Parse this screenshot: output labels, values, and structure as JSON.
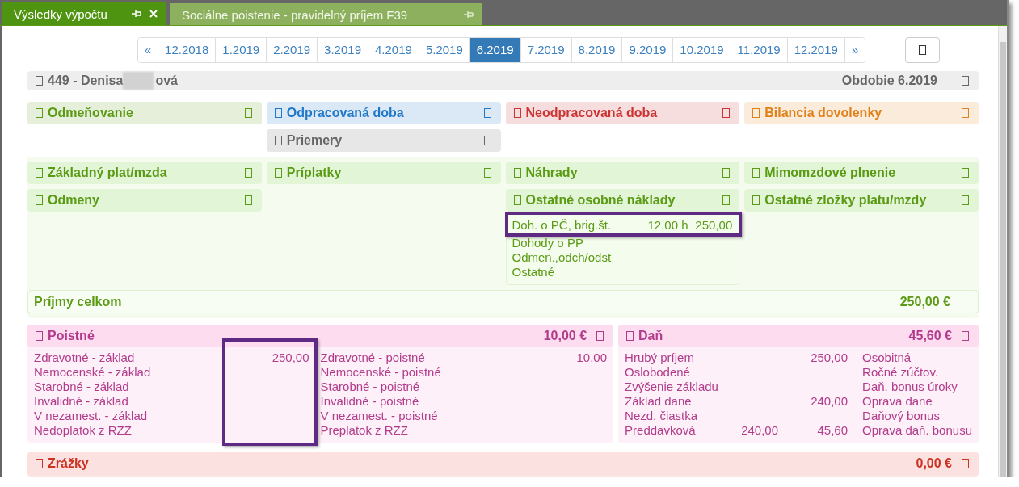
{
  "tabs": [
    {
      "label": "Výsledky výpočtu",
      "selected": true,
      "closable": true
    },
    {
      "label": "Sociálne poistenie - pravidelný príjem F39",
      "selected": false,
      "closable": false
    }
  ],
  "pager": {
    "prev": "«",
    "next": "»",
    "pages": [
      {
        "label": "12.2018",
        "selected": false
      },
      {
        "label": "1.2019",
        "selected": false
      },
      {
        "label": "2.2019",
        "selected": false
      },
      {
        "label": "3.2019",
        "selected": false
      },
      {
        "label": "4.2019",
        "selected": false
      },
      {
        "label": "5.2019",
        "selected": false
      },
      {
        "label": "6.2019",
        "selected": true
      },
      {
        "label": "7.2019",
        "selected": false
      },
      {
        "label": "8.2019",
        "selected": false
      },
      {
        "label": "9.2019",
        "selected": false
      },
      {
        "label": "10.2019",
        "selected": false
      },
      {
        "label": "11.2019",
        "selected": false
      },
      {
        "label": "12.2019",
        "selected": false
      }
    ]
  },
  "employee": {
    "name_start": "449 - Denisa",
    "name_end": "ová",
    "period": "Obdobie 6.2019"
  },
  "overview_columns": [
    [
      {
        "title": "Odmeňovanie",
        "color": "#5b9a14"
      }
    ],
    [
      {
        "title": "Odpracovaná doba",
        "color": "#1f78c8"
      },
      {
        "title": "Priemery",
        "color": "#666666"
      }
    ],
    [
      {
        "title": "Neodpracovaná doba",
        "color": "#cc3333"
      }
    ],
    [
      {
        "title": "Bilancia dovolenky",
        "color": "#e0801a"
      }
    ]
  ],
  "income": {
    "columns": [
      [
        {
          "title": "Základný plat/mzda"
        },
        {
          "title": "Odmeny"
        }
      ],
      [
        {
          "title": "Príplatky"
        }
      ],
      [
        {
          "title": "Náhrady"
        },
        {
          "title": "Ostatné osobné náklady",
          "rows": [
            {
              "label": "Doh. o PČ, brig.št.",
              "hours": "12,00 h",
              "amount": "250,00",
              "highlighted": true
            },
            {
              "label": "Dohody o PP",
              "highlighted": false
            },
            {
              "label": "Odmen.,odch/odst",
              "highlighted": false
            },
            {
              "label": "Ostatné",
              "highlighted": false
            }
          ]
        }
      ],
      [
        {
          "title": "Mimomzdové plnenie"
        },
        {
          "title": "Ostatné zložky platu/mzdy"
        }
      ]
    ],
    "total_label": "Príjmy celkom",
    "total": "250,00 €"
  },
  "insurance": {
    "title": "Poistné",
    "total": "10,00 €",
    "columns": [
      {
        "highlighted": true,
        "rows": [
          {
            "label": "Zdravotné - základ",
            "value": "250,00"
          },
          {
            "label": "Nemocenské - základ"
          },
          {
            "label": "Starobné - základ"
          },
          {
            "label": "Invalidné - základ"
          },
          {
            "label": "V nezamest. - základ"
          },
          {
            "label": "Nedoplatok z RZZ"
          }
        ]
      },
      {
        "highlighted": false,
        "rows": [
          {
            "label": "Zdravotné - poistné",
            "value": "10,00"
          },
          {
            "label": "Nemocenské - poistné"
          },
          {
            "label": "Starobné - poistné"
          },
          {
            "label": "Invalidné - poistné"
          },
          {
            "label": "V nezamest. - poistné"
          },
          {
            "label": "Preplatok z RZZ"
          }
        ]
      }
    ]
  },
  "tax": {
    "title": "Daň",
    "total": "45,60 €",
    "rows": [
      {
        "label": "Hrubý príjem",
        "value": "250,00",
        "other": "Osobitná"
      },
      {
        "label": "Oslobodené",
        "other": "Ročné zúčtov."
      },
      {
        "label": "Zvýšenie základu",
        "other": "Daň. bonus úroky"
      },
      {
        "label": "Základ dane",
        "value": "240,00",
        "other": "Oprava dane"
      },
      {
        "label": "Nezd. čiastka",
        "other": "Daňový bonus"
      },
      {
        "label": "Preddavková",
        "base": "240,00",
        "value": "45,60",
        "other": "Oprava daň. bonusu"
      }
    ]
  },
  "deductions": {
    "title": "Zrážky",
    "total": "0,00 €"
  }
}
